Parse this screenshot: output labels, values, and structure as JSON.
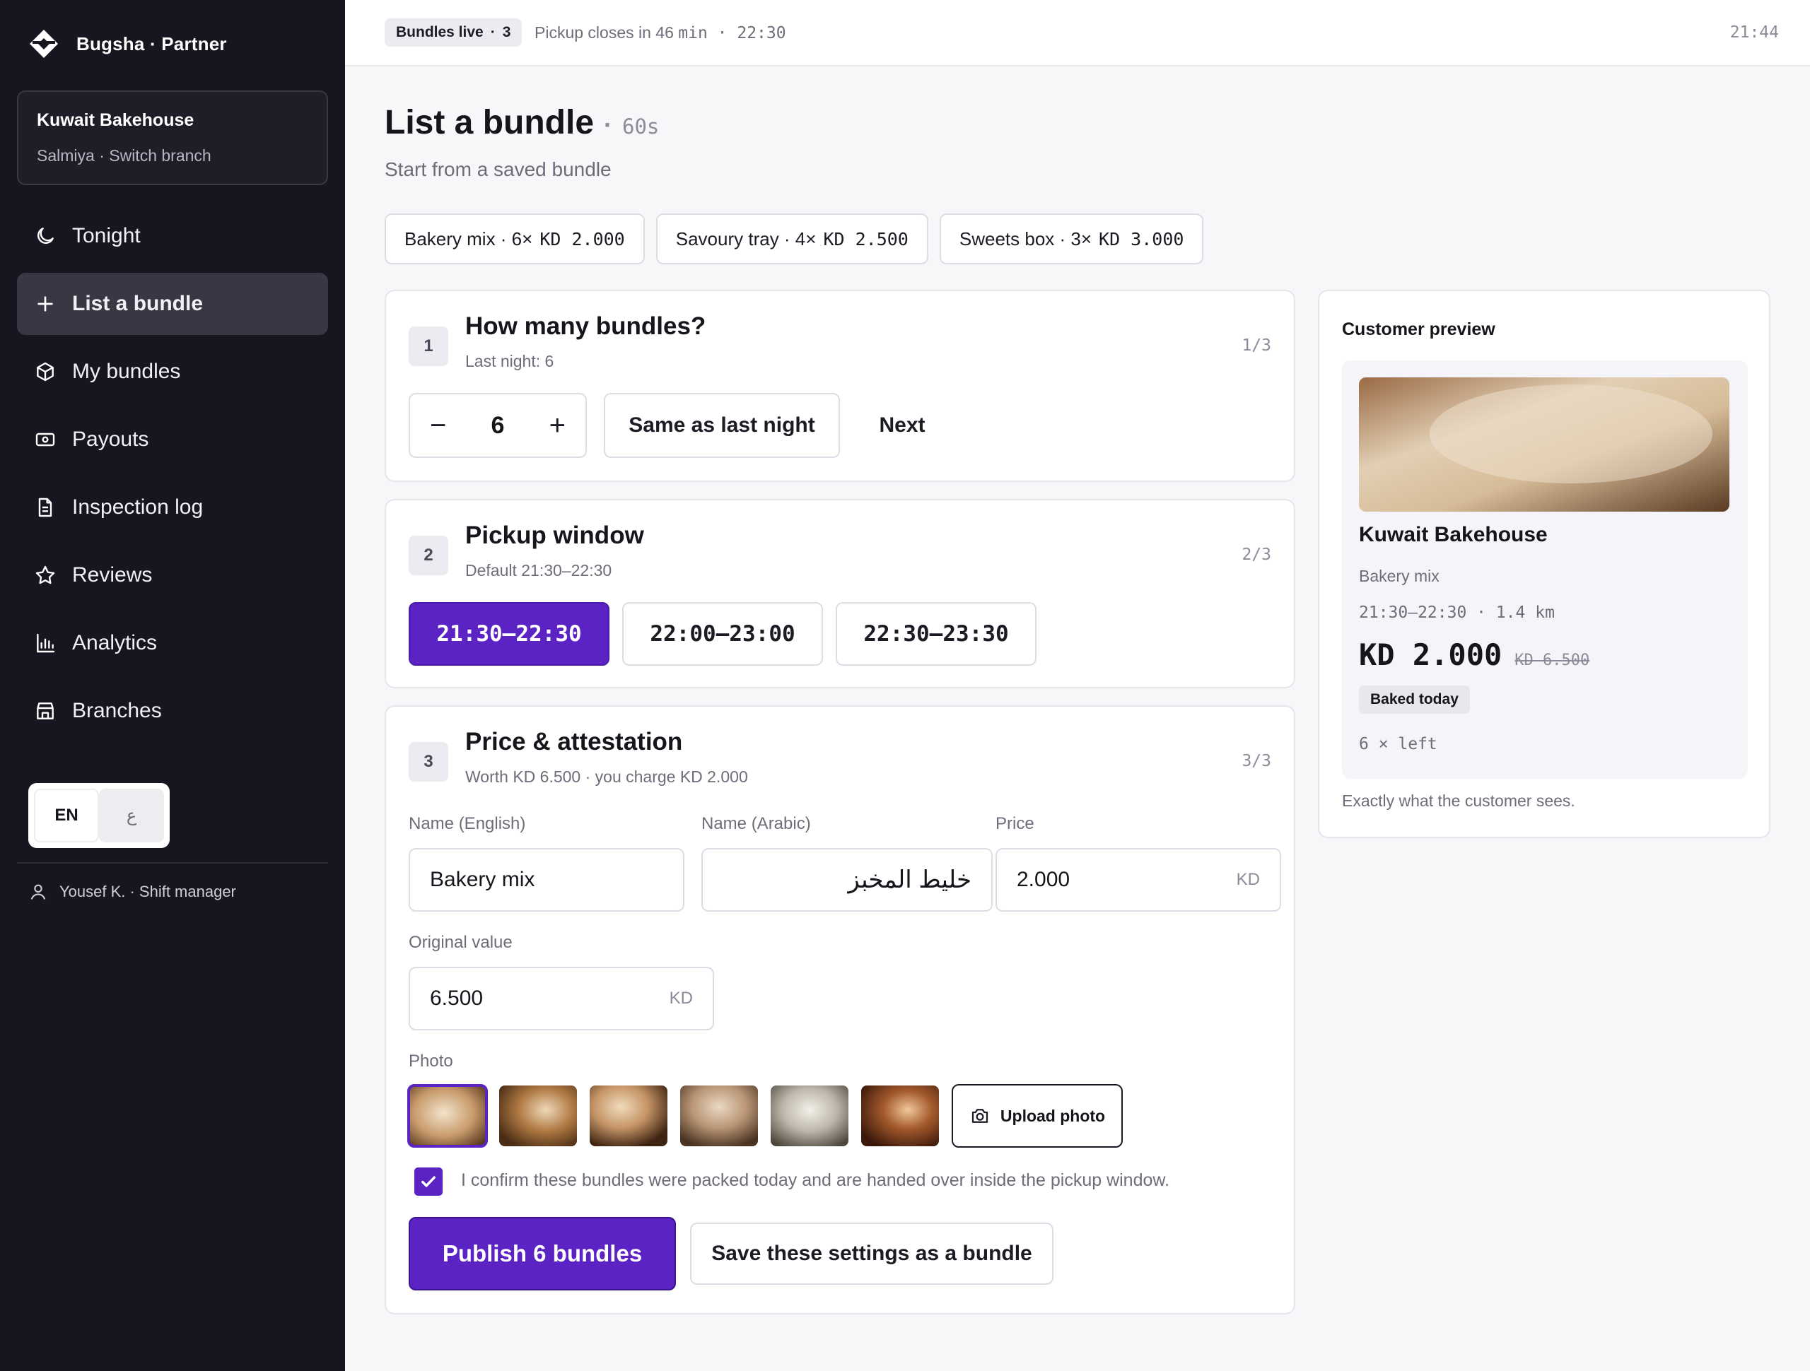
{
  "brand": {
    "name": "Bugsha · Partner"
  },
  "branch": {
    "name": "Kuwait Bakehouse",
    "sub": "Salmiya · Switch branch"
  },
  "nav": [
    {
      "label": "Tonight",
      "icon": "moon-icon"
    },
    {
      "label": "List a bundle",
      "icon": "plus-icon",
      "active": true
    },
    {
      "label": "My bundles",
      "icon": "box-icon"
    },
    {
      "label": "Payouts",
      "icon": "cash-icon"
    },
    {
      "label": "Inspection log",
      "icon": "document-icon"
    },
    {
      "label": "Reviews",
      "icon": "star-icon"
    },
    {
      "label": "Analytics",
      "icon": "bar-chart-icon"
    },
    {
      "label": "Branches",
      "icon": "store-icon"
    }
  ],
  "lang": {
    "en": "EN",
    "ar": "ع"
  },
  "user": {
    "label": "Yousef K. · Shift manager"
  },
  "topbar": {
    "live_label": "Bundles live",
    "live_sep": "·",
    "live_count": "3",
    "pickup_prefix": "Pickup closes in 46",
    "pickup_mono": "min · 22:30",
    "clock": "21:44"
  },
  "page": {
    "title": "List a bundle",
    "dot": "·",
    "timer": "60s",
    "subtitle": "Start from a saved bundle"
  },
  "presets": [
    {
      "name": "Bakery mix · 6×",
      "price": "KD 2.000"
    },
    {
      "name": "Savoury tray · 4×",
      "price": "KD 2.500"
    },
    {
      "name": "Sweets box · 3×",
      "price": "KD 3.000"
    }
  ],
  "step1": {
    "num": "1",
    "title": "How many bundles?",
    "sub": "Last night: 6",
    "count": "1/3",
    "minus": "−",
    "value": "6",
    "plus": "+",
    "same_label": "Same as last night",
    "next_label": "Next"
  },
  "step2": {
    "num": "2",
    "title": "Pickup window",
    "sub": "Default 21:30–22:30",
    "count": "2/3",
    "slots": [
      "21:30–22:30",
      "22:00–23:00",
      "22:30–23:30"
    ]
  },
  "step3": {
    "num": "3",
    "title": "Price & attestation",
    "sub": "Worth KD 6.500 · you charge KD 2.000",
    "count": "3/3",
    "name_en_label": "Name (English)",
    "name_en_value": "Bakery mix",
    "name_ar_label": "Name (Arabic)",
    "name_ar_value": "خليط المخبز",
    "price_label": "Price",
    "price_value": "2.000",
    "price_suffix": "KD",
    "orig_label": "Original value",
    "orig_value": "6.500",
    "orig_suffix": "KD",
    "photo_label": "Photo",
    "upload_label": "Upload photo",
    "confirm_text": "I confirm these bundles were packed today and are handed over inside the pickup window.",
    "confirm_checked": true,
    "publish_label": "Publish 6 bundles",
    "save_label": "Save these settings as a bundle"
  },
  "preview": {
    "title": "Customer preview",
    "name": "Kuwait Bakehouse",
    "bundle": "Bakery mix",
    "meta": "21:30–22:30 · 1.4 km",
    "price_now": "KD 2.000",
    "price_was": "KD 6.500",
    "badge": "Baked today",
    "left": "6 × left",
    "foot": "Exactly what the customer sees."
  },
  "colors": {
    "accent": "#5b22c4",
    "sidebar": "#17151f"
  }
}
